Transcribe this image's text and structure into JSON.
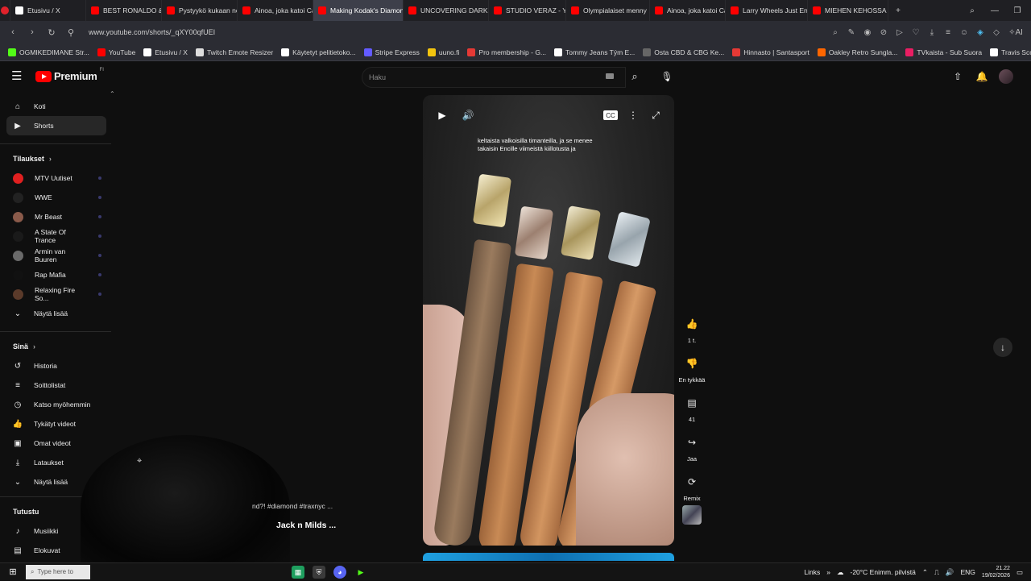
{
  "browser": {
    "tabs": [
      {
        "label": "",
        "color": "#e0222b"
      },
      {
        "label": "Etusivu / X",
        "color": "#ffffff"
      },
      {
        "label": "BEST RONALDO & M",
        "color": "#ff0000"
      },
      {
        "label": "Pystyykö kukaan nos",
        "color": "#ff0000"
      },
      {
        "label": "Ainoa, joka katoi Ca",
        "color": "#ff0000"
      },
      {
        "label": "Making Kodak's Diamond",
        "color": "#ff0000"
      },
      {
        "label": "UNCOVERING DARK E",
        "color": "#ff0000"
      },
      {
        "label": "STUDIO VERAZ - YouT",
        "color": "#ff0000"
      },
      {
        "label": "Olympialaiset menny",
        "color": "#ff0000"
      },
      {
        "label": "Ainoa, joka katoi Ca",
        "color": "#ff0000"
      },
      {
        "label": "Larry Wheels Just End",
        "color": "#ff0000"
      },
      {
        "label": "MIEHEN KEHOSSA O",
        "color": "#ff0000"
      }
    ],
    "url": "www.youtube.com/shorts/_qXY00qfUEI",
    "bookmarks": [
      {
        "label": "OGMIKEDIMANE Str...",
        "color": "#53fc18"
      },
      {
        "label": "YouTube",
        "color": "#ff0000"
      },
      {
        "label": "Etusivu / X",
        "color": "#ffffff"
      },
      {
        "label": "Twitch Emote Resizer",
        "color": "#dddddd"
      },
      {
        "label": "Käytetyt pelitietoko...",
        "color": "#ffffff"
      },
      {
        "label": "Stripe Express",
        "color": "#635bff"
      },
      {
        "label": "uuno.fi",
        "color": "#f2c40f"
      },
      {
        "label": "Pro membership - G...",
        "color": "#e53935"
      },
      {
        "label": "Tommy Jeans Tým E...",
        "color": "#ffffff"
      },
      {
        "label": "Osta CBD & CBG Ke...",
        "color": "#666666"
      },
      {
        "label": "Hinnasto | Santasport",
        "color": "#e53935"
      },
      {
        "label": "Oakley Retro Sungla...",
        "color": "#ff6600"
      },
      {
        "label": "TVkaista - Sub Suora",
        "color": "#e91e63"
      },
      {
        "label": "Travis Scott: Outfits...",
        "color": "#ffffff"
      }
    ]
  },
  "youtube": {
    "logo_text": "Premium",
    "logo_sup": "FI",
    "search_placeholder": "Haku",
    "sidebar": {
      "main": [
        {
          "label": "Koti",
          "icon": "home-icon",
          "glyph": "⌂"
        },
        {
          "label": "Shorts",
          "icon": "shorts-icon",
          "glyph": "▶",
          "active": true
        }
      ],
      "subs_heading": "Tilaukset",
      "subs": [
        {
          "label": "MTV Uutiset",
          "color": "#e02020"
        },
        {
          "label": "WWE",
          "color": "#222222"
        },
        {
          "label": "Mr Beast",
          "color": "#8a5a4a"
        },
        {
          "label": "A State Of Trance",
          "color": "#1a1a1a"
        },
        {
          "label": "Armin van Buuren",
          "color": "#6a6a6a"
        },
        {
          "label": "Rap Mafia",
          "color": "#111111"
        },
        {
          "label": "Relaxing Fire So...",
          "color": "#5a3a2a"
        }
      ],
      "show_more": "Näytä lisää",
      "you_heading": "Sinä",
      "you": [
        {
          "label": "Historia",
          "icon": "history-icon",
          "glyph": "↺"
        },
        {
          "label": "Soittolistat",
          "icon": "playlists-icon",
          "glyph": "≡"
        },
        {
          "label": "Katso myöhemmin",
          "icon": "watch-later-icon",
          "glyph": "◷"
        },
        {
          "label": "Tykätyt videot",
          "icon": "liked-videos-icon",
          "glyph": "👍"
        },
        {
          "label": "Omat videot",
          "icon": "your-videos-icon",
          "glyph": "▣"
        },
        {
          "label": "Lataukset",
          "icon": "downloads-icon",
          "glyph": "⤓"
        }
      ],
      "show_more2": "Näytä lisää",
      "explore_heading": "Tutustu",
      "explore": [
        {
          "label": "Musiikki",
          "icon": "music-icon",
          "glyph": "♪"
        },
        {
          "label": "Elokuvat",
          "icon": "movies-icon",
          "glyph": "▤"
        }
      ]
    },
    "video": {
      "caption_line1": "keltaista valkoisilla timanteilla, ja se menee",
      "caption_line2": "takaisin Encille viimeistä kiillotusta ja",
      "description": "nd?! #diamond #traxnyc ...",
      "channel": "Jack n Milds ..."
    },
    "actions": {
      "like_count": "1 t.",
      "dislike_label": "En tykkää",
      "comments_count": "41",
      "share_label": "Jaa",
      "remix_label": "Remix"
    }
  },
  "taskbar": {
    "search_placeholder": "Type here to",
    "links_label": "Links",
    "weather": "-20°C  Enimm. pilvistä",
    "lang": "ENG",
    "time": "21.22",
    "date": "19/02/2026"
  }
}
